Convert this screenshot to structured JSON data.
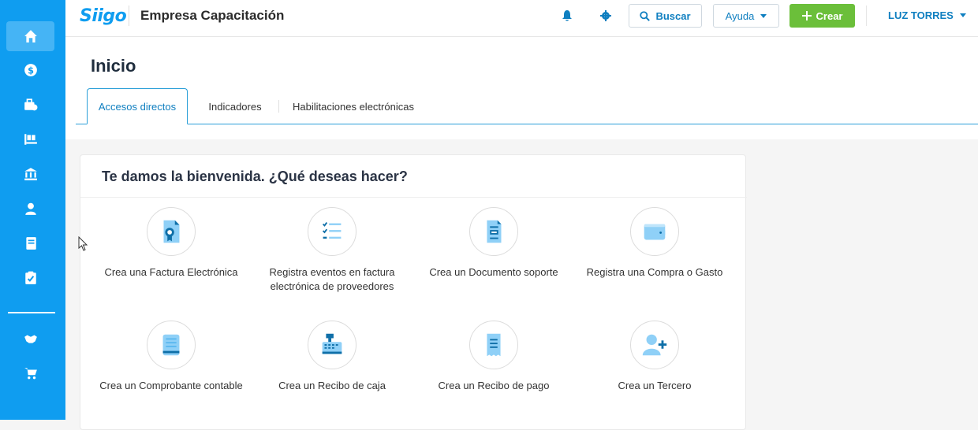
{
  "app": {
    "logo": "Siigo",
    "company": "Empresa Capacitación"
  },
  "topbar": {
    "search_label": "Buscar",
    "help_label": "Ayuda",
    "create_label": "Crear",
    "user_name": "LUZ TORRES"
  },
  "sidebar": {
    "items": [
      {
        "icon": "home-icon"
      },
      {
        "icon": "dollar-icon"
      },
      {
        "icon": "briefcase-icon"
      },
      {
        "icon": "inventory-icon"
      },
      {
        "icon": "bank-icon"
      },
      {
        "icon": "user-icon"
      },
      {
        "icon": "book-icon"
      },
      {
        "icon": "clipboard-check-icon"
      },
      {
        "icon": "handshake-icon"
      },
      {
        "icon": "cart-icon"
      }
    ]
  },
  "page": {
    "title": "Inicio",
    "tabs": [
      {
        "label": "Accesos directos"
      },
      {
        "label": "Indicadores"
      },
      {
        "label": "Habilitaciones electrónicas"
      }
    ]
  },
  "welcome": {
    "title": "Te damos la bienvenida. ¿Qué deseas hacer?",
    "actions": [
      {
        "label": "Crea una Factura Electrónica",
        "icon": "invoice-icon"
      },
      {
        "label": "Registra eventos en factura electrónica de proveedores",
        "icon": "checklist-icon"
      },
      {
        "label": "Crea un Documento soporte",
        "icon": "document-icon"
      },
      {
        "label": "Registra una Compra o Gasto",
        "icon": "wallet-icon"
      },
      {
        "label": "Crea un Comprobante contable",
        "icon": "ledger-icon"
      },
      {
        "label": "Crea un Recibo de caja",
        "icon": "cash-register-icon"
      },
      {
        "label": "Crea un Recibo de pago",
        "icon": "receipt-icon"
      },
      {
        "label": "Crea un Tercero",
        "icon": "add-user-icon"
      }
    ]
  },
  "colors": {
    "sidebar": "#0f9df0",
    "accent": "#0f7fc0",
    "create": "#6bbf3a",
    "icon_light": "#8fd0f7",
    "icon_dark": "#0f6fa8"
  }
}
